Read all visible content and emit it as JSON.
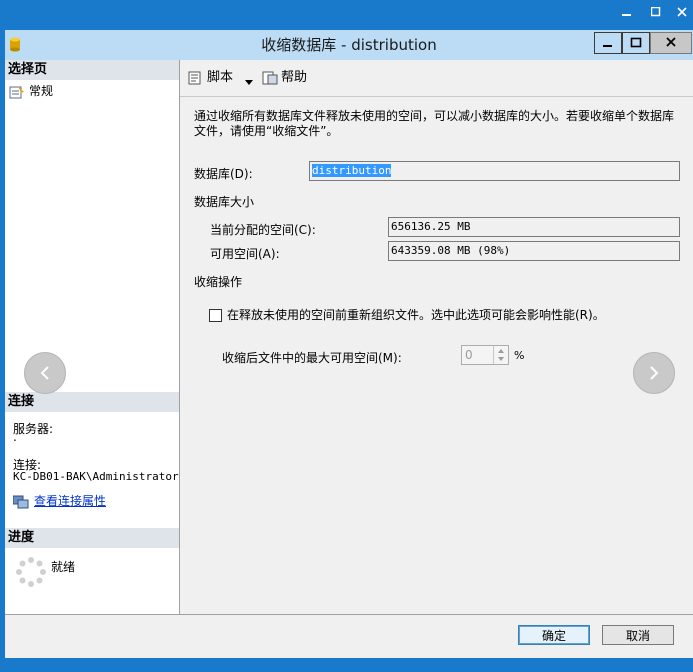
{
  "window": {
    "title": "收缩数据库 - distribution"
  },
  "sidebar": {
    "select_page_header": "选择页",
    "pages": [
      {
        "label": "常规"
      }
    ],
    "connection_header": "连接",
    "server_label": "服务器:",
    "server_value": ".",
    "connection_label": "连接:",
    "connection_value": "KC-DB01-BAK\\Administrator",
    "view_props_link": "查看连接属性",
    "progress_header": "进度",
    "progress_status": "就绪"
  },
  "toolbar": {
    "script_label": "脚本",
    "help_label": "帮助"
  },
  "main": {
    "description": "通过收缩所有数据库文件释放未使用的空间，可以减小数据库的大小。若要收缩单个数据库文件，请使用“收缩文件”。",
    "database_label": "数据库(D):",
    "database_value": "distribution",
    "db_size_header": "数据库大小",
    "allocated_label": "当前分配的空间(C):",
    "allocated_value": "656136.25 MB",
    "available_label": "可用空间(A):",
    "available_value": "643359.08 MB (98%)",
    "shrink_header": "收缩操作",
    "reorg_label": "在释放未使用的空间前重新组织文件。选中此选项可能会影响性能(R)。",
    "reorg_checked": false,
    "max_free_label": "收缩后文件中的最大可用空间(M):",
    "max_free_value": "0",
    "max_free_unit": "%"
  },
  "footer": {
    "ok_label": "确定",
    "cancel_label": "取消"
  },
  "colors": {
    "accent": "#1979ca",
    "title_bar": "#bcdcf5",
    "link": "#0033cc",
    "selection": "#3399ff"
  }
}
